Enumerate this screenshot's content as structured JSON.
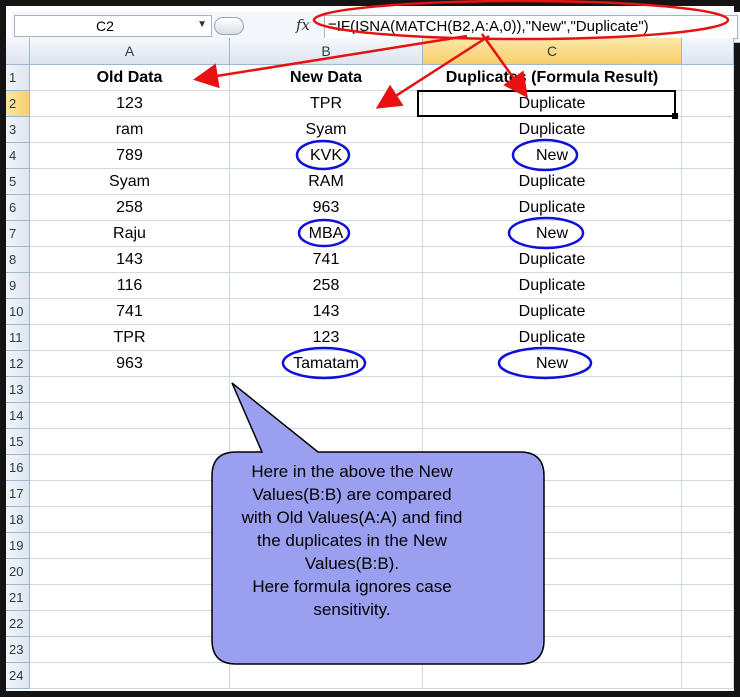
{
  "namebox": {
    "value": "C2"
  },
  "formula_bar": {
    "fx_icon": "fx-icon",
    "formula": "=IF(ISNA(MATCH(B2,A:A,0)),\"New\",\"Duplicate\")"
  },
  "columns": [
    "A",
    "B",
    "C"
  ],
  "rows": [
    "1",
    "2",
    "3",
    "4",
    "5",
    "6",
    "7",
    "8",
    "9",
    "10",
    "11",
    "12",
    "13",
    "14",
    "15",
    "16",
    "17",
    "18",
    "19",
    "20",
    "21",
    "22",
    "23",
    "24"
  ],
  "sheet": {
    "headers": [
      "Old Data",
      "New Data",
      "Duplicates (Formula Result)"
    ],
    "data": [
      [
        "123",
        "TPR",
        "Duplicate"
      ],
      [
        "ram",
        "Syam",
        "Duplicate"
      ],
      [
        "789",
        "KVK",
        "New"
      ],
      [
        "Syam",
        "RAM",
        "Duplicate"
      ],
      [
        "258",
        "963",
        "Duplicate"
      ],
      [
        "Raju",
        "MBA",
        "New"
      ],
      [
        "143",
        "741",
        "Duplicate"
      ],
      [
        "116",
        "258",
        "Duplicate"
      ],
      [
        "741",
        "143",
        "Duplicate"
      ],
      [
        "TPR",
        "123",
        "Duplicate"
      ],
      [
        "963",
        "Tamatam",
        "New"
      ]
    ]
  },
  "callout": {
    "lines": [
      "Here in the above the New",
      "Values(B:B) are compared",
      "with Old Values(A:A) and find",
      "the duplicates in the New",
      "Values(B:B).",
      "Here formula ignores case",
      "sensitivity."
    ]
  },
  "colors": {
    "annotation_red": "#e81010",
    "highlight_blue": "#1010d8",
    "callout_fill": "#9aa0ef",
    "selected_header": "#f8cf6b"
  }
}
